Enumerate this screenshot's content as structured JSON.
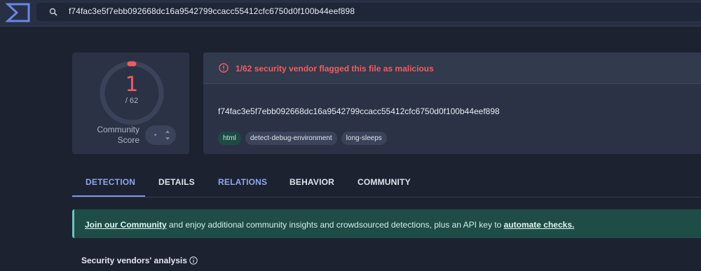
{
  "search": {
    "value": "f74fac3e5f7ebb092668dc16a9542799ccacc55412cfc6750d0f100b44eef898"
  },
  "score": {
    "detections": "1",
    "total": "/ 62",
    "community_label_line1": "Community",
    "community_label_line2": "Score",
    "detection_ratio": 0.0161
  },
  "alert": {
    "text": "1/62 security vendor flagged this file as malicious"
  },
  "file": {
    "hash": "f74fac3e5f7ebb092668dc16a9542799ccacc55412cfc6750d0f100b44eef898",
    "tags": [
      "html",
      "detect-debug-environment",
      "long-sleeps"
    ]
  },
  "tabs": [
    {
      "label": "DETECTION",
      "active": true
    },
    {
      "label": "DETAILS",
      "active": false
    },
    {
      "label": "RELATIONS",
      "active": false
    },
    {
      "label": "BEHAVIOR",
      "active": false
    },
    {
      "label": "COMMUNITY",
      "active": false
    }
  ],
  "banner": {
    "link1": "Join our Community",
    "middle": " and enjoy additional community insights and crowdsourced detections, plus an API key to ",
    "link2": "automate checks."
  },
  "vendors": {
    "title": "Security vendors' analysis"
  },
  "colors": {
    "malicious": "#f25c5c",
    "accent": "#8ea6ee",
    "banner_bg": "#1e4c47"
  },
  "icons": {
    "logo": "virustotal-logo",
    "search": "search-icon",
    "alert": "alert-circle-icon",
    "info": "info-icon"
  }
}
